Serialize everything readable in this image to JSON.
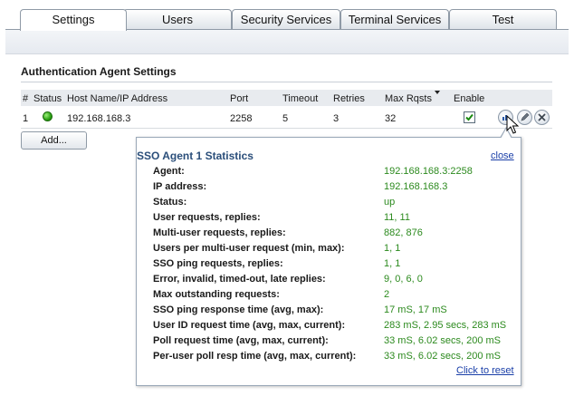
{
  "tabs": [
    {
      "label": "Settings",
      "active": true
    },
    {
      "label": "Users",
      "active": false
    },
    {
      "label": "Security Services",
      "active": false
    },
    {
      "label": "Terminal Services",
      "active": false
    },
    {
      "label": "Test",
      "active": false
    }
  ],
  "section": {
    "title": "Authentication Agent Settings"
  },
  "table": {
    "columns": [
      "#",
      "Status",
      "Host Name/IP Address",
      "Port",
      "Timeout",
      "Retries",
      "Max Rqsts",
      "Enable"
    ],
    "rows": [
      {
        "num": "1",
        "status": "online",
        "host": "192.168.168.3",
        "port": "2258",
        "timeout": "5",
        "retries": "3",
        "max_rqsts": "32",
        "enabled": true
      }
    ]
  },
  "add_button": {
    "label": "Add..."
  },
  "row_actions": {
    "stats_icon": "bar-chart-icon",
    "edit_icon": "pencil-icon",
    "delete_icon": "x-icon"
  },
  "popup": {
    "title": "SSO Agent 1 Statistics",
    "close_label": "close",
    "reset_label": "Click to reset",
    "stats": [
      {
        "label": "Agent:",
        "value": "192.168.168.3:2258"
      },
      {
        "label": "IP address:",
        "value": "192.168.168.3"
      },
      {
        "label": "Status:",
        "value": "up"
      },
      {
        "label": "User requests, replies:",
        "value": "11, 11"
      },
      {
        "label": "Multi-user requests, replies:",
        "value": "882, 876"
      },
      {
        "label": "Users per multi-user request (min, max):",
        "value": "1, 1"
      },
      {
        "label": "SSO ping requests, replies:",
        "value": "1, 1"
      },
      {
        "label": "Error, invalid, timed-out, late replies:",
        "value": "9, 0, 6, 0"
      },
      {
        "label": "Max outstanding requests:",
        "value": "2"
      },
      {
        "label": "SSO ping response time (avg, max):",
        "value": "17 mS, 17 mS"
      },
      {
        "label": "User ID request time (avg, max, current):",
        "value": "283 mS, 2.95 secs, 283 mS"
      },
      {
        "label": "Poll request time (avg, max, current):",
        "value": "33 mS, 6.02 secs, 200 mS"
      },
      {
        "label": "Per-user poll resp time (avg, max, current):",
        "value": "33 mS, 6.02 secs, 200 mS"
      }
    ]
  },
  "colors": {
    "status_ok": "#2aa012",
    "stat_value": "#2c8a1e",
    "link": "#1a3fa8",
    "popup_title": "#2a4e7a"
  }
}
